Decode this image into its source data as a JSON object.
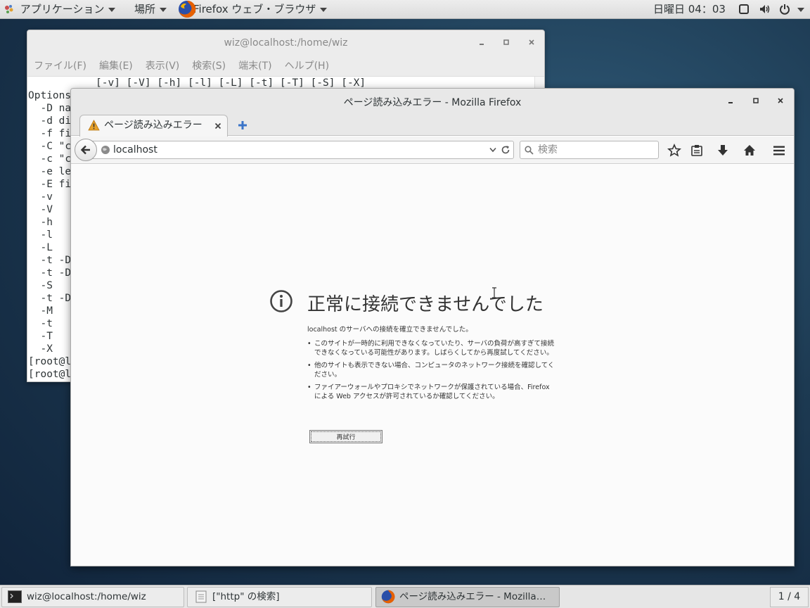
{
  "top_panel": {
    "applications_label": "アプリケーション",
    "places_label": "場所",
    "active_app_label": "Firefox ウェブ・ブラウザ",
    "clock": "日曜日 04：03"
  },
  "terminal": {
    "title": "wiz@localhost:/home/wiz",
    "menu": [
      "ファイル(F)",
      "編集(E)",
      "表示(V)",
      "検索(S)",
      "端末(T)",
      "ヘルプ(H)"
    ],
    "lines": [
      "           [-v] [-V] [-h] [-l] [-L] [-t] [-T] [-S] [-X]",
      "Options",
      "  -D na",
      "  -d di",
      "  -f fi",
      "  -C \"c",
      "  -c \"c",
      "  -e le",
      "  -E fi",
      "  -v",
      "  -V",
      "  -h",
      "  -l",
      "  -L",
      "  -t -D",
      "  -t -D",
      "  -S",
      "  -t -D",
      "  -M",
      "  -t",
      "  -T",
      "  -X",
      "[root@l",
      "[root@l"
    ]
  },
  "firefox": {
    "title": "ページ読み込みエラー - Mozilla Firefox",
    "tab_label": "ページ読み込みエラー",
    "url": "localhost",
    "search_placeholder": "検索",
    "error": {
      "title": "正常に接続できませんでした",
      "intro": "localhost のサーバへの接続を確立できませんでした。",
      "items": [
        "このサイトが一時的に利用できなくなっていたり、サーバの負荷が高すぎて接続できなくなっている可能性があります。しばらくしてから再度試してください。",
        "他のサイトも表示できない場合、コンピュータのネットワーク接続を確認してください。",
        "ファイアーウォールやプロキシでネットワークが保護されている場合、Firefox による Web アクセスが許可されているか確認してください。"
      ],
      "retry_label": "再試行"
    }
  },
  "taskbar": {
    "tasks": [
      "wiz@localhost:/home/wiz",
      "[\"http\" の検索]",
      "ページ読み込みエラー - Mozilla…"
    ],
    "workspace": "1 / 4"
  },
  "colors": {
    "desktop": "#1d3a52",
    "warning": "#e8a22a",
    "firefox_orange": "#e66000"
  }
}
